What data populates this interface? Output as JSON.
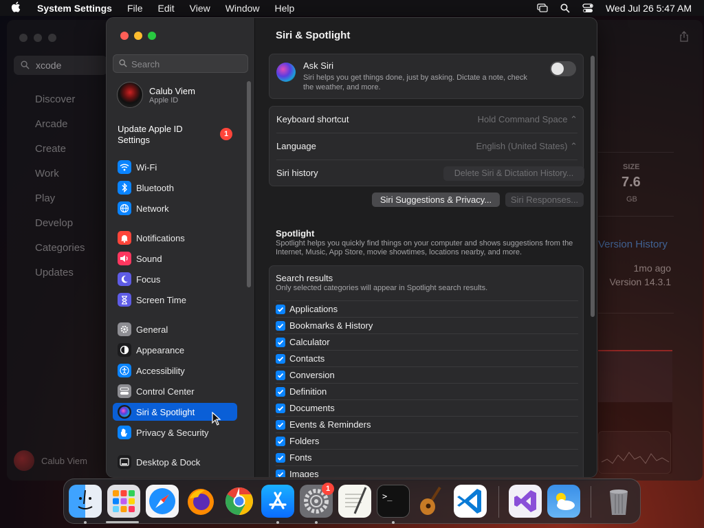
{
  "menubar": {
    "app_name": "System Settings",
    "menus": [
      "File",
      "Edit",
      "View",
      "Window",
      "Help"
    ],
    "datetime": "Wed Jul 26  5:47 AM"
  },
  "background_window": {
    "search_value": "xcode",
    "nav": [
      "Discover",
      "Arcade",
      "Create",
      "Work",
      "Play",
      "Develop",
      "Categories",
      "Updates"
    ],
    "user_name": "Calub Viem",
    "size_label": "SIZE",
    "size_value": "7.6",
    "size_unit": "GB",
    "version_history": "Version History",
    "updated_ago": "1mo ago",
    "version": "Version 14.3.1"
  },
  "sidebar": {
    "search_placeholder": "Search",
    "account_name": "Calub Viem",
    "account_sub": "Apple ID",
    "update_label": "Update Apple ID Settings",
    "update_badge": "1",
    "items": [
      {
        "label": "Wi-Fi",
        "icon": "wifi-icon",
        "color": "#0a84ff"
      },
      {
        "label": "Bluetooth",
        "icon": "bluetooth-icon",
        "color": "#0a84ff"
      },
      {
        "label": "Network",
        "icon": "globe-icon",
        "color": "#0a84ff"
      },
      {
        "label": "Notifications",
        "icon": "bell-icon",
        "color": "#ff453a"
      },
      {
        "label": "Sound",
        "icon": "speaker-icon",
        "color": "#ff375f"
      },
      {
        "label": "Focus",
        "icon": "moon-icon",
        "color": "#5e5ce6"
      },
      {
        "label": "Screen Time",
        "icon": "hourglass-icon",
        "color": "#5e5ce6"
      },
      {
        "label": "General",
        "icon": "gear-icon",
        "color": "#8e8e93"
      },
      {
        "label": "Appearance",
        "icon": "appearance-icon",
        "color": "#1c1c1e"
      },
      {
        "label": "Accessibility",
        "icon": "accessibility-icon",
        "color": "#0a84ff"
      },
      {
        "label": "Control Center",
        "icon": "control-center-icon",
        "color": "#8e8e93"
      },
      {
        "label": "Siri & Spotlight",
        "icon": "siri-icon",
        "color": "#1c1c1e"
      },
      {
        "label": "Privacy & Security",
        "icon": "hand-icon",
        "color": "#0a84ff"
      },
      {
        "label": "Desktop & Dock",
        "icon": "dock-icon",
        "color": "#1c1c1e"
      }
    ]
  },
  "content": {
    "title": "Siri & Spotlight",
    "ask_siri": {
      "title": "Ask Siri",
      "description": "Siri helps you get things done, just by asking. Dictate a note, check the weather, and more.",
      "enabled": false
    },
    "keyboard_shortcut": {
      "label": "Keyboard shortcut",
      "value": "Hold Command Space"
    },
    "language": {
      "label": "Language",
      "value": "English (United States)"
    },
    "siri_history": {
      "label": "Siri history",
      "button": "Delete Siri & Dictation History..."
    },
    "suggestions_button": "Siri Suggestions & Privacy...",
    "responses_button": "Siri Responses...",
    "spotlight": {
      "title": "Spotlight",
      "description": "Spotlight helps you quickly find things on your computer and shows suggestions from the Internet, Music, App Store, movie showtimes, locations nearby, and more."
    },
    "search_results": {
      "title": "Search results",
      "description": "Only selected categories will appear in Spotlight search results.",
      "categories": [
        "Applications",
        "Bookmarks & History",
        "Calculator",
        "Contacts",
        "Conversion",
        "Definition",
        "Documents",
        "Events & Reminders",
        "Folders",
        "Fonts",
        "Images"
      ]
    }
  },
  "dock": {
    "system_settings_badge": "1",
    "apps": [
      {
        "name": "finder-icon"
      },
      {
        "name": "launchpad-icon"
      },
      {
        "name": "safari-icon"
      },
      {
        "name": "firefox-icon"
      },
      {
        "name": "chrome-icon"
      },
      {
        "name": "app-store-icon"
      },
      {
        "name": "system-settings-icon"
      },
      {
        "name": "textedit-icon"
      },
      {
        "name": "terminal-icon"
      },
      {
        "name": "garageband-icon"
      },
      {
        "name": "vscode-icon"
      },
      {
        "name": "visual-studio-icon"
      },
      {
        "name": "weather-icon"
      },
      {
        "name": "trash-icon"
      }
    ]
  }
}
